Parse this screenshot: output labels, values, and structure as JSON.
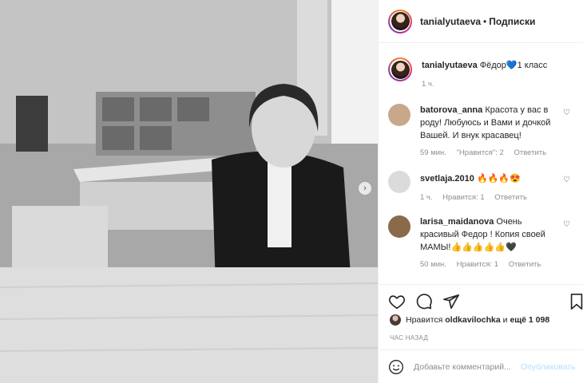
{
  "post": {
    "author": "tanialyutaeva",
    "separator": "•",
    "follow_status": "Подписки"
  },
  "caption": {
    "user": "tanialyutaeva",
    "text": "Фёдор💙1 класс",
    "time": "1 ч."
  },
  "comments": [
    {
      "user": "batorova_anna",
      "text": "Красота у вас в роду! Любуюсь и Вами и дочкой Вашей. И внук красавец!",
      "time": "59 мин.",
      "likes": "\"Нравится\": 2",
      "reply": "Ответить",
      "avatar_color": "#c9a78a"
    },
    {
      "user": "svetlaja.2010",
      "text": "🔥🔥🔥😍",
      "time": "1 ч.",
      "likes": "Нравится: 1",
      "reply": "Ответить",
      "avatar_color": "#dbdbdb"
    },
    {
      "user": "larisa_maidanova",
      "text": "Очень красивый Федор ! Копия своей МАМЫ!👍👍👍👍👍🖤",
      "time": "50 мин.",
      "likes": "Нравится: 1",
      "reply": "Ответить",
      "avatar_color": "#8a6a4a"
    }
  ],
  "likes": {
    "prefix": "Нравится",
    "user": "oldkavilochka",
    "middle": "и",
    "count": "ещё 1 098"
  },
  "timestamp": "ЧАС НАЗАД",
  "add_comment": {
    "placeholder": "Добавьте комментарий...",
    "publish": "Опубликовать"
  },
  "icons": {
    "carousel_next": "›",
    "comment_like": "♡"
  }
}
